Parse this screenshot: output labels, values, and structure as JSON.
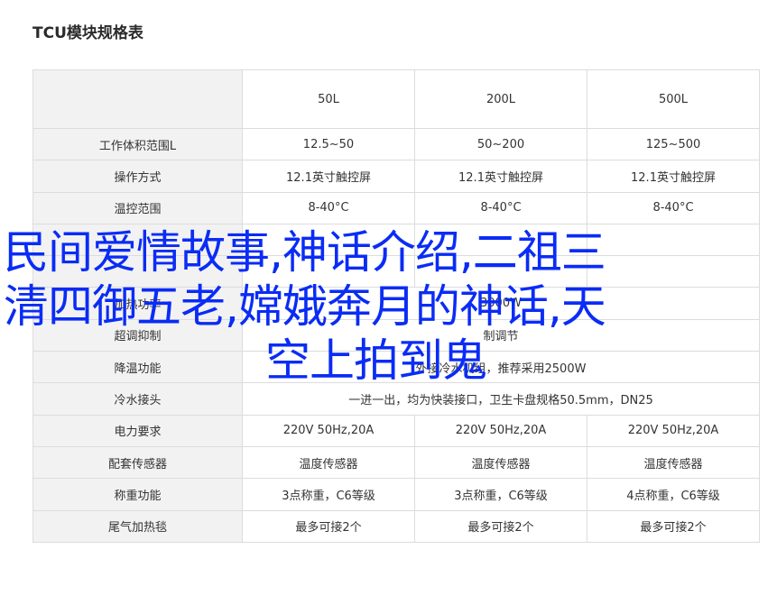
{
  "title": "TCU模块规格表",
  "table": {
    "columns": [
      "50L",
      "200L",
      "500L"
    ],
    "rows": [
      {
        "label": "工作体积范围L",
        "cells": [
          "12.5~50",
          "50~200",
          "125~500"
        ]
      },
      {
        "label": "操作方式",
        "cells": [
          "12.1英寸触控屏",
          "12.1英寸触控屏",
          "12.1英寸触控屏"
        ]
      },
      {
        "label": "温控范围",
        "cells": [
          "8-40°C",
          "8-40°C",
          "8-40°C"
        ]
      },
      {
        "label": "",
        "cells": [
          "",
          "",
          ""
        ]
      },
      {
        "label": "",
        "cells": [
          "",
          "",
          ""
        ]
      },
      {
        "label": "加热功率",
        "cells": [
          "",
          "3000W",
          ""
        ],
        "merged": "3000W"
      },
      {
        "label": "超调抑制",
        "merged": "制调节"
      },
      {
        "label": "降温功能",
        "merged": "外接冷水机组，推荐采用2500W"
      },
      {
        "label": "冷水接头",
        "merged": "一进一出，均为快装接口，卫生卡盘规格50.5mm，DN25"
      },
      {
        "label": "电力要求",
        "cells": [
          "220V 50Hz,20A",
          "220V 50Hz,20A",
          "220V 50Hz,20A"
        ]
      },
      {
        "label": "配套传感器",
        "cells": [
          "温度传感器",
          "温度传感器",
          "温度传感器"
        ]
      },
      {
        "label": "称重功能",
        "cells": [
          "3点称重，C6等级",
          "3点称重，C6等级",
          "4点称重，C6等级"
        ]
      },
      {
        "label": "尾气加热毯",
        "cells": [
          "最多可接2个",
          "最多可接2个",
          "最多可接2个"
        ]
      }
    ]
  },
  "overlay": {
    "line1": "民间爱情故事,神话介绍,二祖三",
    "line2": "清四御五老,嫦娥奔月的神话,天",
    "line3": "空上拍到鬼"
  }
}
